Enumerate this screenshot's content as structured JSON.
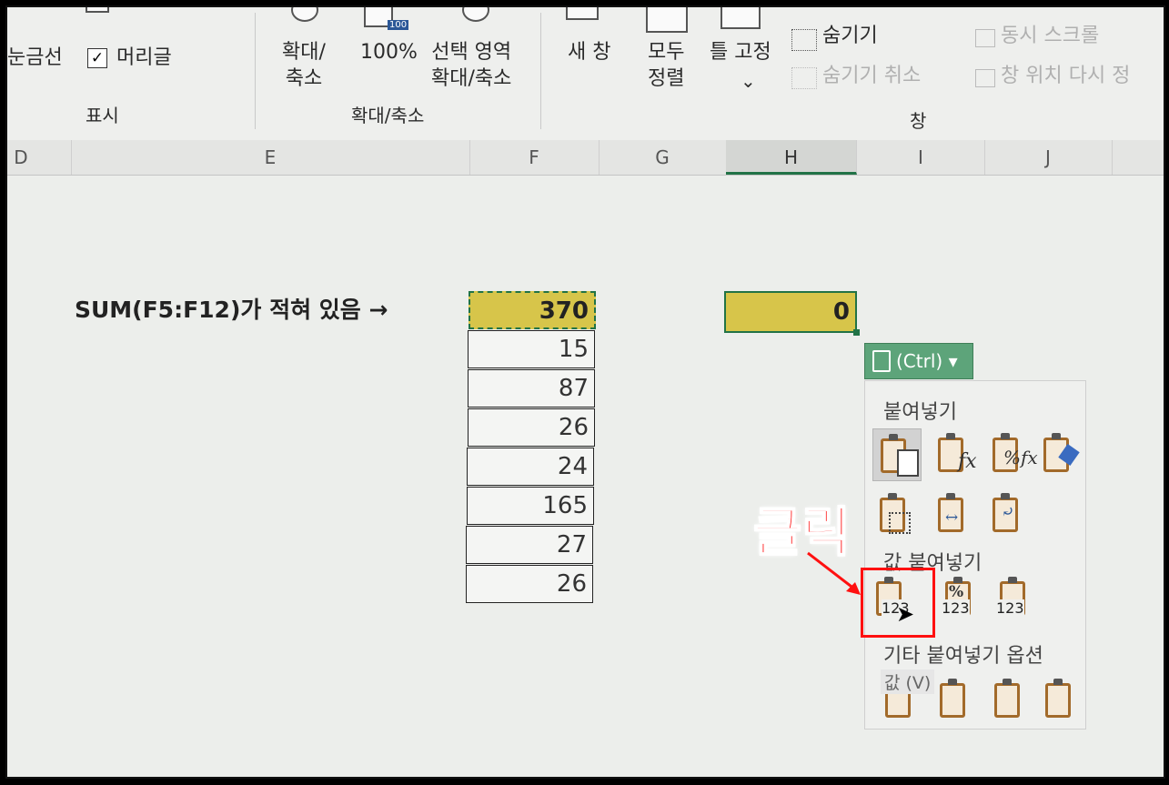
{
  "ribbon": {
    "show_group": {
      "gridlines": "눈금선",
      "headings": "머리글",
      "title": "표시"
    },
    "zoom_group": {
      "zoom": "확대/\n축소",
      "zoom_100": "100%",
      "zoom_icon_badge": "100",
      "zoom_selection": "선택 영역\n확대/축소",
      "title": "확대/축소"
    },
    "window_group": {
      "new_window": "새 창",
      "arrange_all": "모두\n정렬",
      "freeze_panes": "틀 고정",
      "freeze_chevron": "⌄",
      "hide": "숨기기",
      "unhide": "숨기기 취소",
      "sync_scroll": "동시 스크롤",
      "reset_position": "창 위치 다시 정",
      "title": "창"
    }
  },
  "columns": [
    {
      "label": "D"
    },
    {
      "label": "E"
    },
    {
      "label": "F"
    },
    {
      "label": "G"
    },
    {
      "label": "H",
      "selected": true
    },
    {
      "label": "I"
    },
    {
      "label": "J"
    }
  ],
  "sheet": {
    "note": "SUM(F5:F12)가 적혀 있음 →",
    "f_cells": [
      "370",
      "15",
      "87",
      "26",
      "24",
      "165",
      "27",
      "26"
    ],
    "h_cell": "0"
  },
  "paste_menu": {
    "button_label": "(Ctrl)",
    "button_chevron": "▾",
    "section_paste": "붙여넣기",
    "section_values": "값 붙여넣기",
    "section_other": "기타 붙여넣기 옵션",
    "paste_icons": [
      "paste-icon",
      "formulas-icon",
      "formulas-number-formatting-icon",
      "keep-source-formatting-icon",
      "no-borders-icon",
      "keep-column-widths-icon",
      "transpose-icon"
    ],
    "fx_overlay": "fx",
    "percent_fx_overlay": "%fx",
    "percent_overlay": "%",
    "value_number": "123",
    "tooltip": "값 (V)"
  },
  "annotation": {
    "text": "클릭",
    "color": "#ff2020"
  },
  "colors": {
    "selection_green": "#217346",
    "cell_fill": "#d7c54a",
    "ctrl_button": "#5da47a"
  }
}
